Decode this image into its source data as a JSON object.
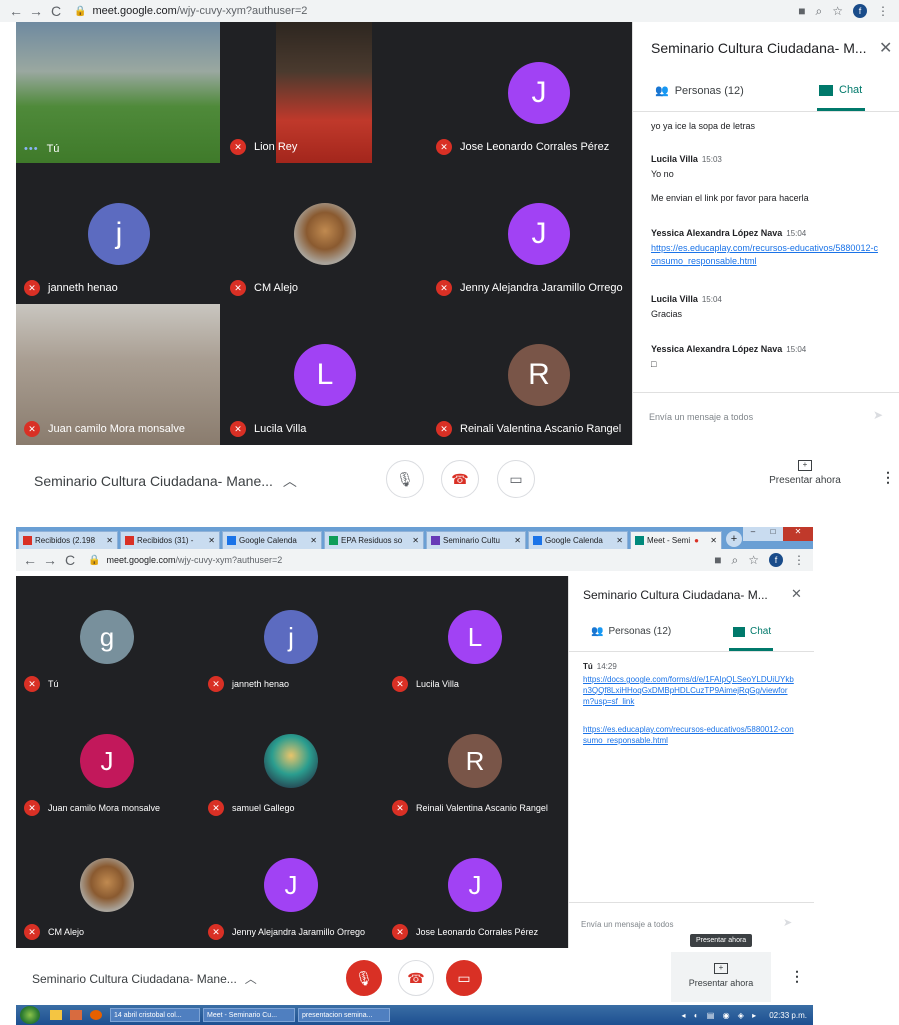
{
  "shot1": {
    "url_host": "meet.google.com",
    "url_path": "/wjy-cuvy-xym?authuser=2",
    "profile_initial": "f",
    "tiles": [
      {
        "name": "Tú",
        "type": "photo"
      },
      {
        "name": "Lion Rey",
        "type": "photo"
      },
      {
        "name": "Jose Leonardo Corrales Pérez",
        "initial": "J",
        "color": "#a142f4"
      },
      {
        "name": "janneth henao",
        "initial": "j",
        "color": "#5c6bc0"
      },
      {
        "name": "CM Alejo",
        "type": "avatar-photo"
      },
      {
        "name": "Jenny Alejandra Jaramillo Orrego",
        "initial": "J",
        "color": "#a142f4"
      },
      {
        "name": "Juan camilo Mora monsalve",
        "type": "photo"
      },
      {
        "name": "Lucila Villa",
        "initial": "L",
        "color": "#a142f4"
      },
      {
        "name": "Reinali Valentina Ascanio Rangel",
        "initial": "R",
        "color": "#795548"
      }
    ],
    "panel": {
      "title": "Seminario Cultura Ciudadana- M...",
      "tab_people": "Personas (12)",
      "tab_chat": "Chat",
      "messages": [
        {
          "text": "yo ya ice la sopa de letras"
        },
        {
          "author": "Lucila Villa",
          "time": "15:03",
          "text": "Yo no"
        },
        {
          "text": "Me envian el link por favor para hacerla"
        },
        {
          "author": "Yessica Alexandra López Nava",
          "time": "15:04",
          "link": "https://es.educaplay.com/recursos-educativos/5880012-consumo_responsable.html"
        },
        {
          "author": "Lucila Villa",
          "time": "15:04",
          "text": "Gracias"
        },
        {
          "author": "Yessica Alexandra López Nava",
          "time": "15:04",
          "text": "□"
        }
      ],
      "input_placeholder": "Envía un mensaje a todos"
    },
    "meeting_title": "Seminario Cultura Ciudadana- Mane...",
    "present_label": "Presentar ahora"
  },
  "shot2": {
    "tabs": [
      {
        "label": "Recibidos (2.198",
        "color": "#d93025"
      },
      {
        "label": "Recibidos (31) - ",
        "color": "#d93025"
      },
      {
        "label": "Google Calenda",
        "color": "#1a73e8"
      },
      {
        "label": "EPA Residuos so",
        "color": "#0f9d58"
      },
      {
        "label": "Seminario Cultu",
        "color": "#673ab7"
      },
      {
        "label": "Google Calenda",
        "color": "#1a73e8"
      },
      {
        "label": "Meet - Semi",
        "color": "#00897b"
      }
    ],
    "url_host": "meet.google.com",
    "url_path": "/wjy-cuvy-xym?authuser=2",
    "profile_initial": "f",
    "tiles": [
      {
        "name": "Tú",
        "initial": "g",
        "color": "#78909c"
      },
      {
        "name": "janneth henao",
        "initial": "j",
        "color": "#5c6bc0"
      },
      {
        "name": "Lucila Villa",
        "initial": "L",
        "color": "#a142f4"
      },
      {
        "name": "Juan camilo Mora monsalve",
        "initial": "J",
        "color": "#c2185b"
      },
      {
        "name": "samuel Gallego",
        "type": "avatar-photo"
      },
      {
        "name": "Reinali Valentina Ascanio Rangel",
        "initial": "R",
        "color": "#795548"
      },
      {
        "name": "CM Alejo",
        "type": "avatar-photo"
      },
      {
        "name": "Jenny Alejandra Jaramillo Orrego",
        "initial": "J",
        "color": "#a142f4"
      },
      {
        "name": "Jose Leonardo Corrales Pérez",
        "initial": "J",
        "color": "#a142f4"
      }
    ],
    "panel": {
      "title": "Seminario Cultura Ciudadana- M...",
      "tab_people": "Personas (12)",
      "tab_chat": "Chat",
      "author": "Tú",
      "time": "14:29",
      "link1": "https://docs.google.com/forms/d/e/1FAIpQLSeoYLDUiUYkbn3QQf8LxiHHoqGxDMBpHDLCuzTP9AimejRqGg/viewform?usp=sf_link",
      "link2": "https://es.educaplay.com/recursos-educativos/5880012-consumo_responsable.html",
      "input_placeholder": "Envía un mensaje a todos"
    },
    "tooltip": "Presentar ahora",
    "meeting_title": "Seminario Cultura Ciudadana- Mane...",
    "present_label": "Presentar ahora",
    "taskbar": [
      {
        "label": "14 abril cristobal col..."
      },
      {
        "label": "Meet - Seminario Cu..."
      },
      {
        "label": "presentacion semina..."
      }
    ],
    "clock": "02:33 p.m."
  }
}
